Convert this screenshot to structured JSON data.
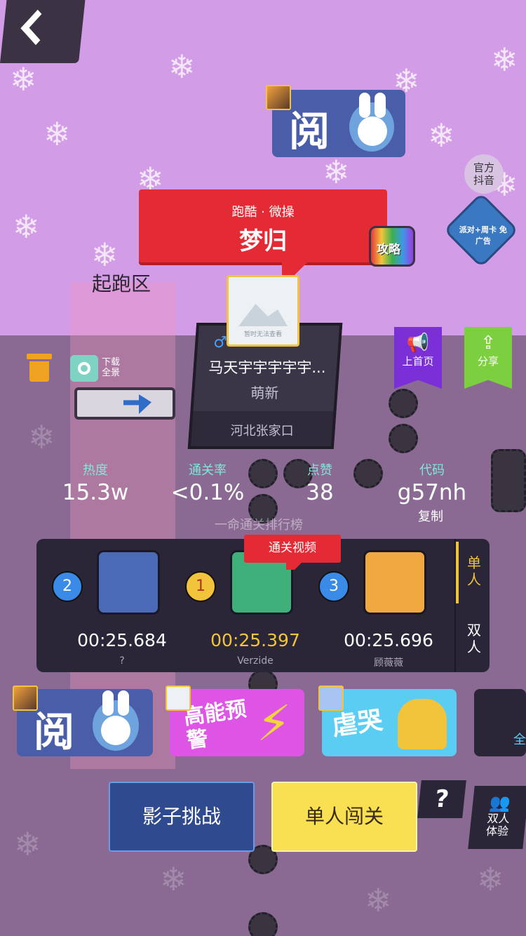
{
  "header": {
    "back_label": "back"
  },
  "top_card": {
    "big_char": "阅"
  },
  "official": {
    "label_line1": "官方",
    "label_line2": "抖音"
  },
  "promo": {
    "text": "派对+周卡 免广告"
  },
  "level": {
    "tags": "跑酷 · 微操",
    "title": "梦归",
    "start_zone_label": "起跑区",
    "thumb_text": "暂时无法查看",
    "guide_label": "攻略"
  },
  "author": {
    "gender_symbol": "♂",
    "name": "马天宇宇宇宇宇...",
    "level": "萌新",
    "location": "河北张家口"
  },
  "tools": {
    "download_line1": "下载",
    "download_line2": "全景"
  },
  "actions": {
    "to_home": "上首页",
    "share": "分享"
  },
  "stats": {
    "heat_label": "热度",
    "heat_value": "15.3w",
    "clear_label": "通关率",
    "clear_value": "<0.1%",
    "likes_label": "点赞",
    "likes_value": "38",
    "code_label": "代码",
    "code_value": "g57nh",
    "copy_label": "复制"
  },
  "leaderboard": {
    "title": "一命通关排行榜",
    "video_tag": "通关视频",
    "tab_single": "单人",
    "tab_double": "双人",
    "entries": [
      {
        "rank": "2",
        "time": "00:25.684",
        "player": "?"
      },
      {
        "rank": "1",
        "time": "00:25.397",
        "player": "Verzide"
      },
      {
        "rank": "3",
        "time": "00:25.696",
        "player": "顾薇薇"
      }
    ]
  },
  "recommend": [
    {
      "text": "阅"
    },
    {
      "text": "高能预警"
    },
    {
      "text": "虐哭"
    },
    {
      "text": "全"
    }
  ],
  "buttons": {
    "shadow": "影子挑战",
    "solo": "单人闯关",
    "help": "?",
    "duo_line1": "双人",
    "duo_line2": "体验"
  },
  "colors": {
    "accent_red": "#e42b35",
    "gold": "#f2c43b",
    "mint": "#7fe8d8",
    "purple": "#7b2fd6",
    "green": "#7ccf3e"
  }
}
